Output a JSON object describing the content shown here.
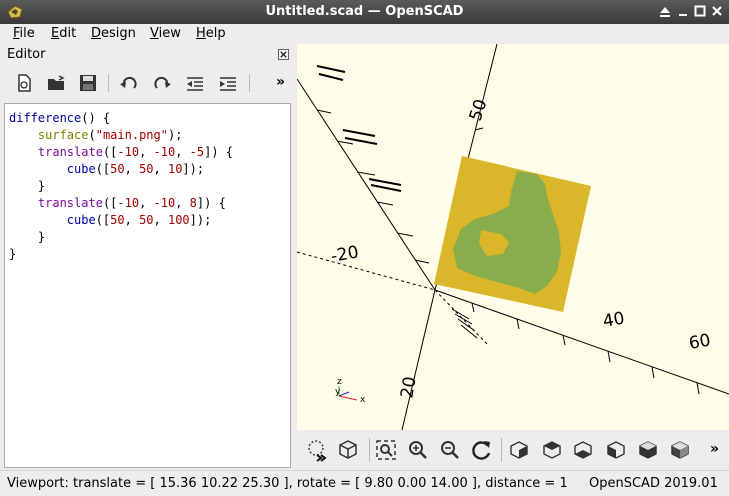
{
  "window": {
    "title": "Untitled.scad — OpenSCAD"
  },
  "menu": {
    "file": "File",
    "edit": "Edit",
    "design": "Design",
    "view": "View",
    "help": "Help"
  },
  "editor": {
    "title": "Editor",
    "toolbar_icons": [
      "new-file-icon",
      "open-file-icon",
      "save-icon",
      "undo-icon",
      "redo-icon",
      "unindent-icon",
      "indent-icon",
      "more-icon"
    ],
    "more_label": "»",
    "code": {
      "l1a": "difference",
      "l1b": "() {",
      "l2a": "surface",
      "l2b": "(",
      "l2c": "\"main.png\"",
      "l2d": ");",
      "l3a": "translate",
      "l3b": "([",
      "l3c": "-10",
      "l3d": ", ",
      "l3e": "-10",
      "l3f": ", ",
      "l3g": "-5",
      "l3h": "]) {",
      "l4a": "cube",
      "l4b": "([",
      "l4c": "50",
      "l4d": ", ",
      "l4e": "50",
      "l4f": ", ",
      "l4g": "10",
      "l4h": "]);",
      "l5": "}",
      "l6a": "translate",
      "l6b": "([",
      "l6c": "-10",
      "l6d": ", ",
      "l6e": "-10",
      "l6f": ", ",
      "l6g": "8",
      "l6h": "]) {",
      "l7a": "cube",
      "l7b": "([",
      "l7c": "50",
      "l7d": ", ",
      "l7e": "50",
      "l7f": ", ",
      "l7g": "100",
      "l7h": "]);",
      "l8": "}",
      "l9": "}"
    }
  },
  "viewport": {
    "axis_labels": [
      "50",
      "40",
      "20",
      "-20",
      "60",
      "20"
    ],
    "model_colors": {
      "base": "#d9b62a",
      "shape": "#8aad4b"
    },
    "axis_indicator": {
      "z": "z",
      "y": "y",
      "x": "x"
    }
  },
  "view_toolbar": {
    "icons": [
      "preview-icon",
      "render-icon",
      "view-all-icon",
      "zoom-in-icon",
      "zoom-out-icon",
      "reset-view-icon",
      "view-right-icon",
      "view-top-icon",
      "view-bottom-icon",
      "view-left-icon",
      "view-front-icon",
      "view-back-icon",
      "more-icon"
    ],
    "more_label": "»"
  },
  "status": {
    "viewport": "Viewport: translate = [ 15.36 10.22 25.30 ], rotate = [ 9.80 0.00 14.00 ], distance = 1",
    "version": "OpenSCAD 2019.01"
  }
}
